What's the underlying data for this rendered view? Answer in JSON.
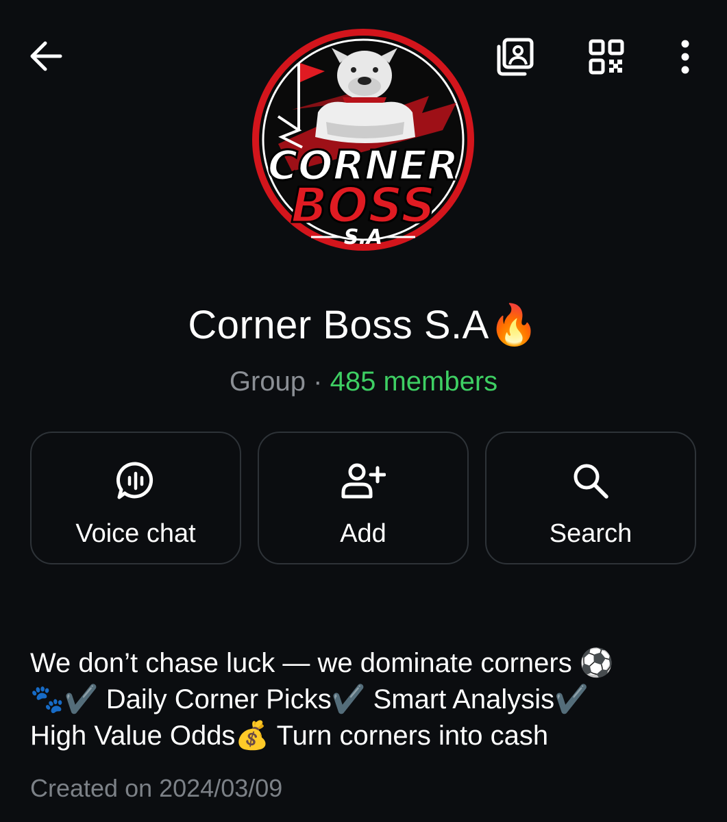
{
  "header": {
    "back_icon": "arrow-left-icon",
    "media_icon": "shared-media-icon",
    "qr_icon": "qr-code-icon",
    "more_icon": "more-vertical-icon"
  },
  "avatar": {
    "logo_text_line1": "CORNER",
    "logo_text_line2": "BOSS",
    "logo_text_line3": "S.A",
    "accent_color": "#d3151c"
  },
  "group": {
    "name": "Corner Boss S.A🔥",
    "type": "Group",
    "separator": "·",
    "members": "485 members",
    "members_color": "#3ecf63"
  },
  "actions": [
    {
      "label": "Voice chat",
      "icon": "voice-chat-icon"
    },
    {
      "label": "Add",
      "icon": "add-member-icon"
    },
    {
      "label": "Search",
      "icon": "search-icon"
    }
  ],
  "description": {
    "line1": "We don’t chase luck — we dominate corners ⚽",
    "line2": "🐾✔️ Daily Corner Picks✔️ Smart Analysis✔️",
    "line3": "High Value Odds💰 Turn corners into cash"
  },
  "created": "Created on 2024/03/09"
}
